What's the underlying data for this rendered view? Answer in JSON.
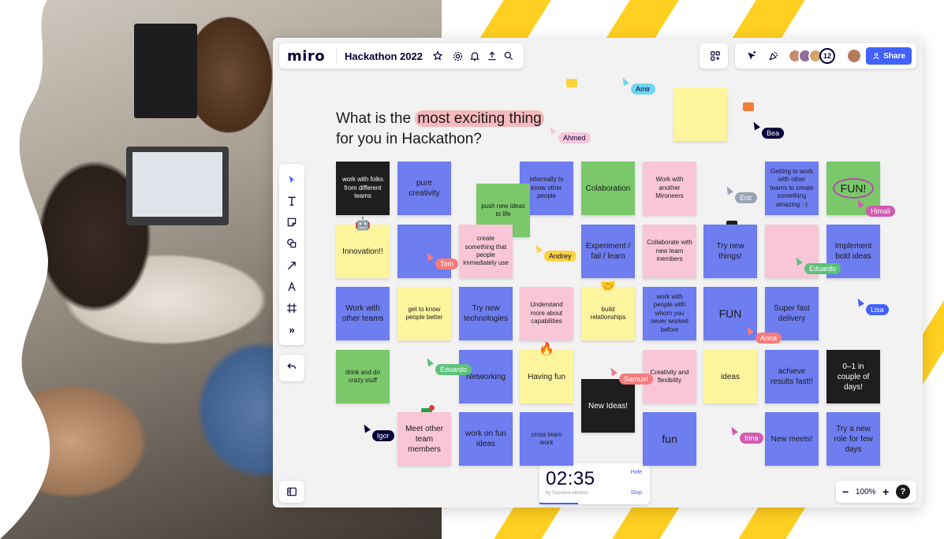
{
  "app": {
    "logo": "miro",
    "board_title": "Hackathon 2022",
    "share_label": "Share",
    "collaborator_count": "12",
    "zoom_level": "100%",
    "help_label": "?"
  },
  "question": {
    "line1_pre": "What is the ",
    "line1_highlight": "most exciting thing",
    "line2": "for you in Hackathon?"
  },
  "timer": {
    "time": "02:35",
    "by": "by Suzanne Abrams",
    "hide": "Hide",
    "stop": "Stop",
    "progress": 0.35
  },
  "colors": {
    "accent": "#4262ff",
    "blue": "#6e7df0",
    "green": "#7ac86a",
    "pink": "#f9c6d8",
    "yellow": "#fdf59e",
    "black": "#1e1e1e",
    "stripe": "#ffd021"
  },
  "notes": [
    {
      "text": "work with folks from different teams",
      "color": "black"
    },
    {
      "text": "pure creativity",
      "color": "blue"
    },
    {
      "text": "informally to know other people",
      "color": "blue"
    },
    {
      "text": "push new ideas to life",
      "color": "green"
    },
    {
      "text": "Colaboration",
      "color": "green"
    },
    {
      "text": "Work with another Mironeers",
      "color": "pink"
    },
    {
      "text": "Getting to work with other teams to create something amazing :-)",
      "color": "blue"
    },
    {
      "text": "FUN!",
      "color": "green"
    },
    {
      "text": "Innovation!!",
      "color": "yellow",
      "icon": "robot-icon"
    },
    {
      "text": "",
      "color": "blue"
    },
    {
      "text": "create something that people immediately use",
      "color": "pink"
    },
    {
      "text": "Experiment / fail / learn",
      "color": "blue"
    },
    {
      "text": "Collaborate with new team members",
      "color": "pink"
    },
    {
      "text": "Try new things!",
      "color": "blue"
    },
    {
      "text": "",
      "color": "pink"
    },
    {
      "text": "Implement bold ideas",
      "color": "blue"
    },
    {
      "text": "Work with other teams",
      "color": "blue"
    },
    {
      "text": "get to know people better",
      "color": "yellow"
    },
    {
      "text": "Try new technologies",
      "color": "blue"
    },
    {
      "text": "Understand more about capabilities",
      "color": "pink"
    },
    {
      "text": "build relationships",
      "color": "yellow",
      "icon": "handshake-icon"
    },
    {
      "text": "work with people with whom you never worked before",
      "color": "blue"
    },
    {
      "text": "FUN",
      "color": "blue"
    },
    {
      "text": "Super fast delivery",
      "color": "blue"
    },
    {
      "text": "drink and do crazy stuff",
      "color": "green"
    },
    {
      "text": "Networking",
      "color": "blue"
    },
    {
      "text": "Having fun",
      "color": "yellow",
      "icon": "fire-icon"
    },
    {
      "text": "New Ideas!",
      "color": "black"
    },
    {
      "text": "Creativity and flexibility",
      "color": "pink"
    },
    {
      "text": "ideas",
      "color": "yellow"
    },
    {
      "text": "achieve results fast!!",
      "color": "blue"
    },
    {
      "text": "0–1 in couple of days!",
      "color": "black"
    },
    {
      "text": "Meet other team members",
      "color": "pink"
    },
    {
      "text": "work on fun ideas",
      "color": "blue"
    },
    {
      "text": "cross team work",
      "color": "blue"
    },
    {
      "text": "fun",
      "color": "blue"
    },
    {
      "text": "New meets!",
      "color": "blue"
    },
    {
      "text": "Try a new role for few days",
      "color": "blue"
    },
    {
      "text": "",
      "color": "yellow"
    }
  ],
  "cursors": [
    {
      "name": "Amir",
      "color": "#6fd6f2"
    },
    {
      "name": "Ahmed",
      "color": "#f9c6d8"
    },
    {
      "name": "Bea",
      "color": "#050038"
    },
    {
      "name": "Eric",
      "color": "#9aa2b6"
    },
    {
      "name": "Himali",
      "color": "#d35ab3"
    },
    {
      "name": "Tom",
      "color": "#f47c7c"
    },
    {
      "name": "Andrey",
      "color": "#fcd33b"
    },
    {
      "name": "Eduardo",
      "color": "#5cc27a"
    },
    {
      "name": "Lisa",
      "color": "#4262ff"
    },
    {
      "name": "Anna",
      "color": "#f47c7c"
    },
    {
      "name": "Eduardo",
      "color": "#5cc27a"
    },
    {
      "name": "Samuel",
      "color": "#f47c7c"
    },
    {
      "name": "Igor",
      "color": "#050038"
    },
    {
      "name": "Irina",
      "color": "#d35ab3"
    }
  ]
}
